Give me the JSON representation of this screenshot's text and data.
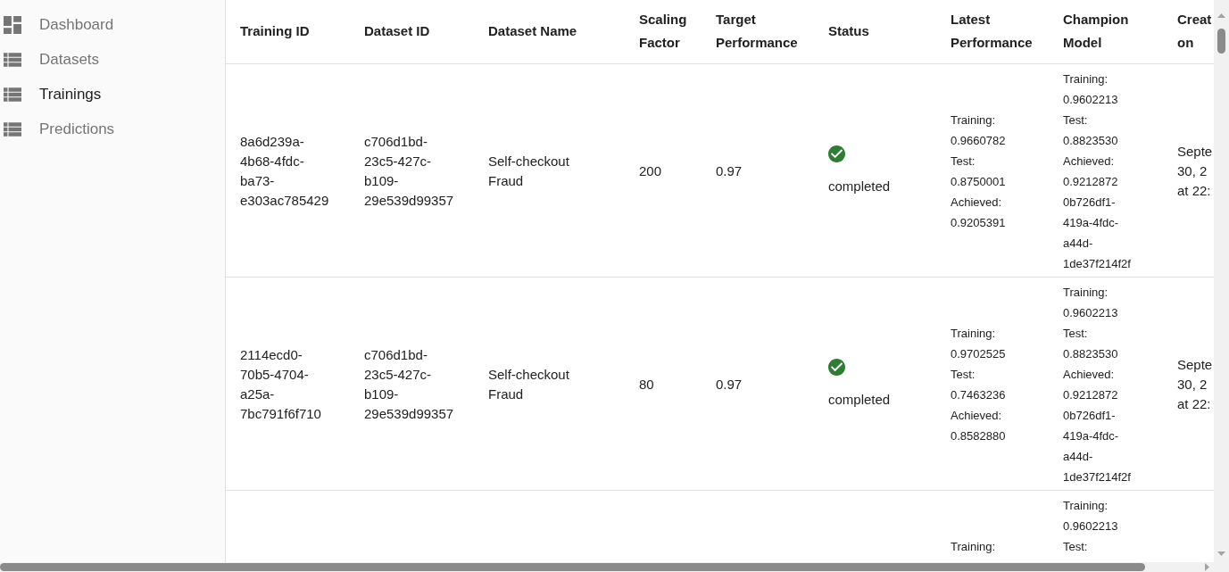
{
  "sidebar": {
    "items": [
      {
        "label": "Dashboard",
        "kind": "dashboard",
        "selected": false
      },
      {
        "label": "Datasets",
        "kind": "list",
        "selected": false
      },
      {
        "label": "Trainings",
        "kind": "list",
        "selected": true
      },
      {
        "label": "Predictions",
        "kind": "list",
        "selected": false
      }
    ]
  },
  "table": {
    "columns": [
      "Training ID",
      "Dataset ID",
      "Dataset Name",
      "Scaling Factor",
      "Target Performance",
      "Status",
      "Latest Performance",
      "Champion Model",
      "Creat on"
    ],
    "rows": [
      {
        "training_id": "8a6d239a-4b68-4fdc-ba73-e303ac785429",
        "dataset_id": "c706d1bd-23c5-427c-b109-29e539d99357",
        "dataset_name": "Self-checkout Fraud",
        "scaling_factor": "200",
        "target_performance": "0.97",
        "status": {
          "label": "completed",
          "kind": "success"
        },
        "latest_performance": [
          {
            "label": "Training:",
            "value": "0.9660782"
          },
          {
            "label": "Test:",
            "value": "0.8750001"
          },
          {
            "label": "Achieved:",
            "value": "0.9205391"
          }
        ],
        "champion_model": {
          "metrics": [
            {
              "label": "Training:",
              "value": "0.9602213"
            },
            {
              "label": "Test:",
              "value": "0.8823530"
            },
            {
              "label": "Achieved:",
              "value": "0.9212872"
            }
          ],
          "id": "0b726df1-419a-4fdc-a44d-1de37f214f2f"
        },
        "created_on": "Septe 30, 2 at 22:"
      },
      {
        "training_id": "2114ecd0-70b5-4704-a25a-7bc791f6f710",
        "dataset_id": "c706d1bd-23c5-427c-b109-29e539d99357",
        "dataset_name": "Self-checkout Fraud",
        "scaling_factor": "80",
        "target_performance": "0.97",
        "status": {
          "label": "completed",
          "kind": "success"
        },
        "latest_performance": [
          {
            "label": "Training:",
            "value": "0.9702525"
          },
          {
            "label": "Test:",
            "value": "0.7463236"
          },
          {
            "label": "Achieved:",
            "value": "0.8582880"
          }
        ],
        "champion_model": {
          "metrics": [
            {
              "label": "Training:",
              "value": "0.9602213"
            },
            {
              "label": "Test:",
              "value": "0.8823530"
            },
            {
              "label": "Achieved:",
              "value": "0.9212872"
            }
          ],
          "id": "0b726df1-419a-4fdc-a44d-1de37f214f2f"
        },
        "created_on": "Septe 30, 2 at 22:"
      },
      {
        "latest_performance": [
          {
            "label": "Training:"
          }
        ],
        "champion_model": {
          "metrics": [
            {
              "label": "Training:",
              "value": "0.9602213"
            },
            {
              "label": "Test:"
            }
          ]
        }
      }
    ]
  }
}
